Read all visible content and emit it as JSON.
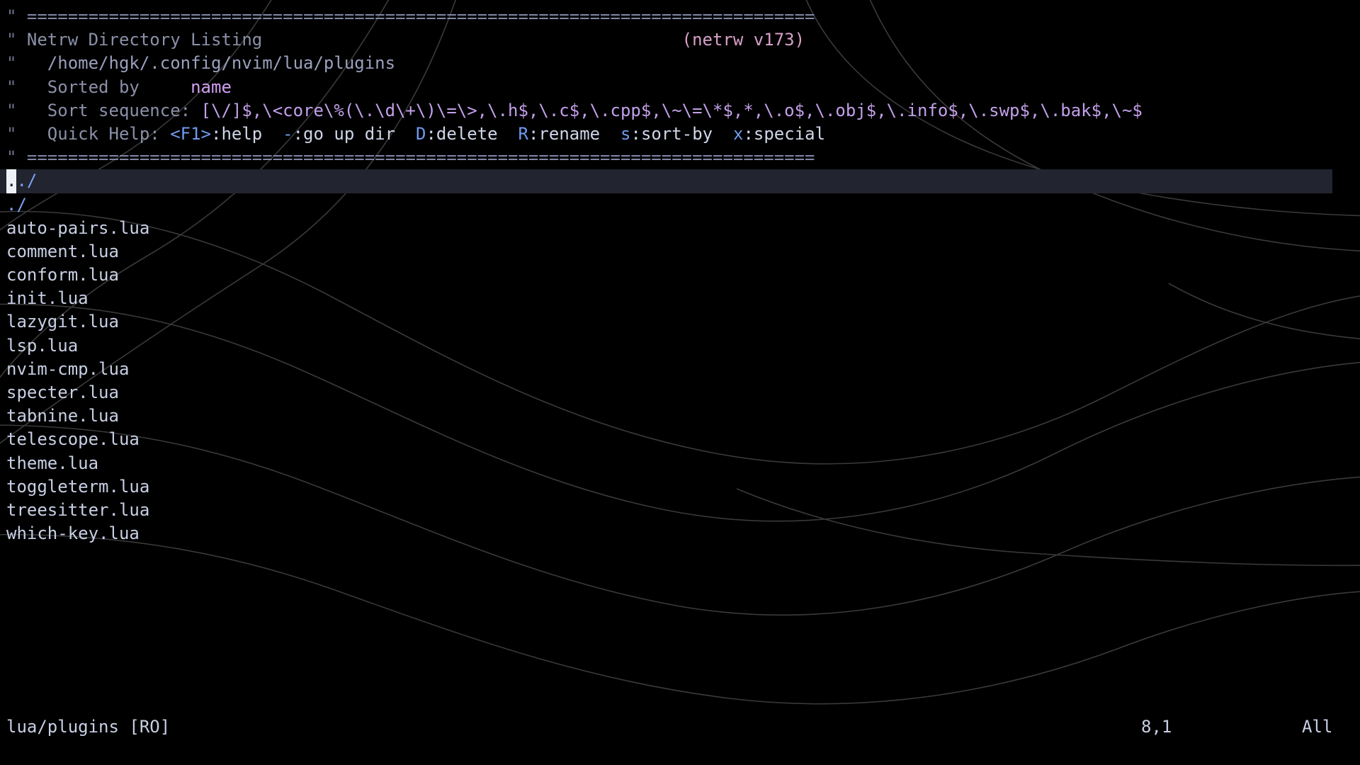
{
  "app": {
    "name": "neovim-netrw",
    "background": "#000000",
    "foreground": "#c8cfe4",
    "cursorline_bg": "#22242f",
    "cursor_bg": "#eef1f7",
    "dir_color": "#7aa2f7",
    "accent_purple": "#cfa0f0",
    "accent_blue": "#6f9aee"
  },
  "banner": {
    "quote": "\"",
    "separator_top": " =============================================================================",
    "separator_bottom": " =============================================================================",
    "title": " Netrw Directory Listing",
    "version": "(netrw v173)",
    "path": "   /home/hgk/.config/nvim/lua/plugins",
    "sorted_by_label": "   Sorted by",
    "sorted_by_value": "name",
    "sort_sequence_label": "   Sort sequence: ",
    "sort_sequence_value": "[\\/]$,\\<core\\%(\\.\\d\\+\\)\\=\\>,\\.h$,\\.c$,\\.cpp$,\\~\\=\\*$,*,\\.o$,\\.obj$,\\.info$,\\.swp$,\\.bak$,\\~$",
    "quick_help_label": "   Quick Help: ",
    "quick_help_items": [
      {
        "key": "<F1>",
        "desc": ":help"
      },
      {
        "key": "-",
        "desc": ":go up dir"
      },
      {
        "key": "D",
        "desc": ":delete"
      },
      {
        "key": "R",
        "desc": ":rename"
      },
      {
        "key": "s",
        "desc": ":sort-by"
      },
      {
        "key": "x",
        "desc": ":special"
      }
    ]
  },
  "listing": {
    "cursor_entry": {
      "cursor_char": ".",
      "rest": "./",
      "full": "../",
      "type": "dir"
    },
    "entries": [
      {
        "name": "./",
        "type": "dir"
      },
      {
        "name": "auto-pairs.lua",
        "type": "file"
      },
      {
        "name": "comment.lua",
        "type": "file"
      },
      {
        "name": "conform.lua",
        "type": "file"
      },
      {
        "name": "init.lua",
        "type": "file"
      },
      {
        "name": "lazygit.lua",
        "type": "file"
      },
      {
        "name": "lsp.lua",
        "type": "file"
      },
      {
        "name": "nvim-cmp.lua",
        "type": "file"
      },
      {
        "name": "specter.lua",
        "type": "file"
      },
      {
        "name": "tabnine.lua",
        "type": "file"
      },
      {
        "name": "telescope.lua",
        "type": "file"
      },
      {
        "name": "theme.lua",
        "type": "file"
      },
      {
        "name": "toggleterm.lua",
        "type": "file"
      },
      {
        "name": "treesitter.lua",
        "type": "file"
      },
      {
        "name": "which-key.lua",
        "type": "file"
      }
    ]
  },
  "statusline": {
    "buffer_name": "lua/plugins [RO]",
    "ruler": "8,1",
    "position": "All"
  }
}
